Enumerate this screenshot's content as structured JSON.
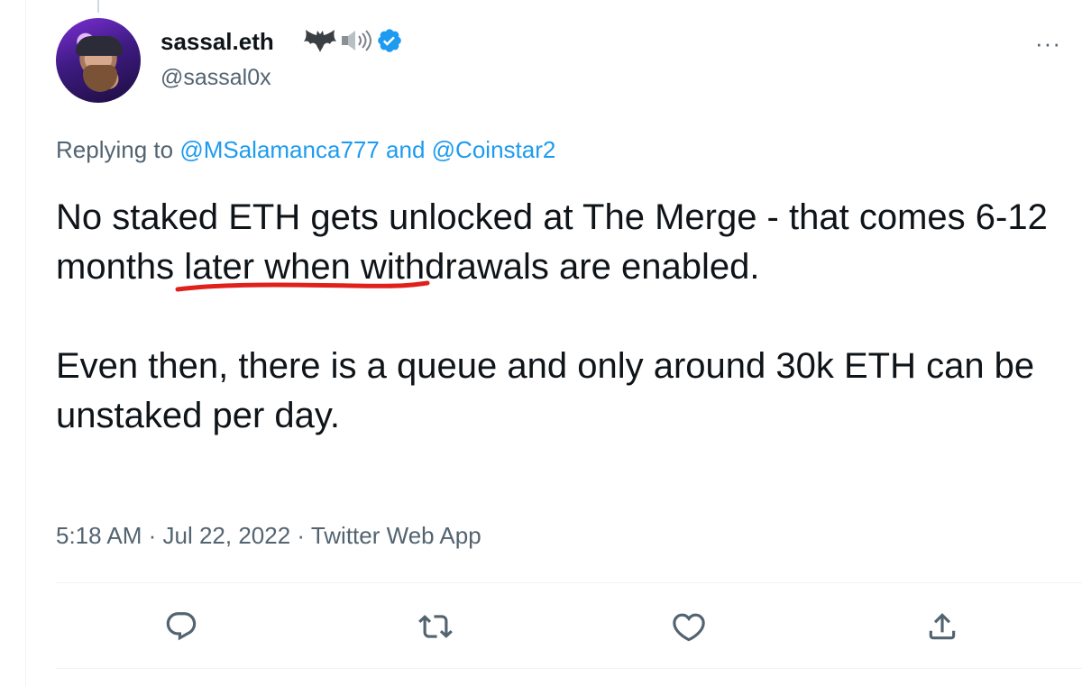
{
  "author": {
    "display_name": "sassal.eth",
    "name_emoji": [
      "bat",
      "speaker"
    ],
    "handle": "@sassal0x",
    "verified": true
  },
  "more_menu": "···",
  "reply_context": {
    "prefix": "Replying to ",
    "mention_1": "@MSalamanca777",
    "conjunction": " and ",
    "mention_2": "@Coinstar2"
  },
  "tweet": {
    "text_before_highlight": "No staked ETH gets unlocked at The Merge - that comes ",
    "highlighted_text": "6-12 months",
    "text_after_highlight": " later when withdrawals are enabled.\n\nEven then, there is a queue and only around 30k ETH can be unstaked per day."
  },
  "meta": {
    "time": "5:18 AM",
    "separator": " · ",
    "date": "Jul 22, 2022",
    "source": "Twitter Web App"
  },
  "actions": [
    "reply-icon",
    "retweet-icon",
    "like-icon",
    "share-icon"
  ],
  "colors": {
    "link": "#1d9bf0",
    "secondary_text": "#536471",
    "verified_badge": "#1d9bf0",
    "highlight_underline": "#e0201b"
  }
}
